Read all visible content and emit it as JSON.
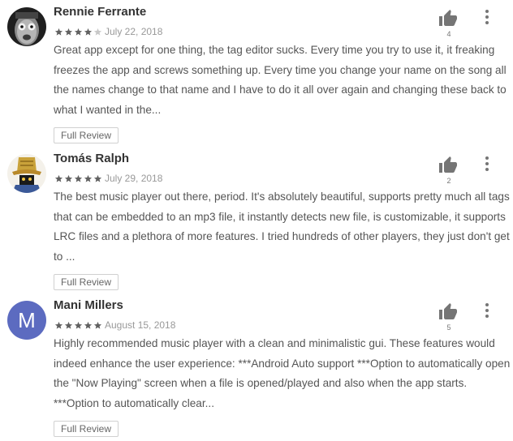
{
  "reviews": [
    {
      "author": "Rennie Ferrante",
      "rating": 4,
      "date": "July 22, 2018",
      "text": "Great app except for one thing, the tag editor sucks. Every time you try to use it, it freaking freezes the app and screws something up. Every time you change your name on the song all the names change to that name and I have to do it all over again and changing these back to what I wanted in the...",
      "helpful_count": "4",
      "full_review_label": "Full Review",
      "avatar": "photo"
    },
    {
      "author": "Tomás Ralph",
      "rating": 5,
      "date": "July 29, 2018",
      "text": "The best music player out there, period. It's absolutely beautiful, supports pretty much all tags that can be embedded to an mp3 file, it instantly detects new file, is customizable, it supports LRC files and a plethora of more features. I tried hundreds of other players, they just don't get to ...",
      "helpful_count": "2",
      "full_review_label": "Full Review",
      "avatar": "illustration"
    },
    {
      "author": "Mani Millers",
      "rating": 5,
      "date": "August 15, 2018",
      "text": "Highly recommended music player with a clean and minimalistic gui. These features would indeed enhance the user experience: ***Android Auto support ***Option to automatically open the \"Now Playing\" screen when a file is opened/played and also when the app starts. ***Option to automatically clear...",
      "helpful_count": "5",
      "full_review_label": "Full Review",
      "avatar_letter": "M",
      "avatar_color": "#5c6bc0"
    }
  ],
  "colors": {
    "star_filled": "#616161",
    "star_empty": "#c8c8c8",
    "icon": "#757575"
  },
  "icons": [
    "thumb-up-icon",
    "more-vert-icon",
    "star-icon"
  ]
}
